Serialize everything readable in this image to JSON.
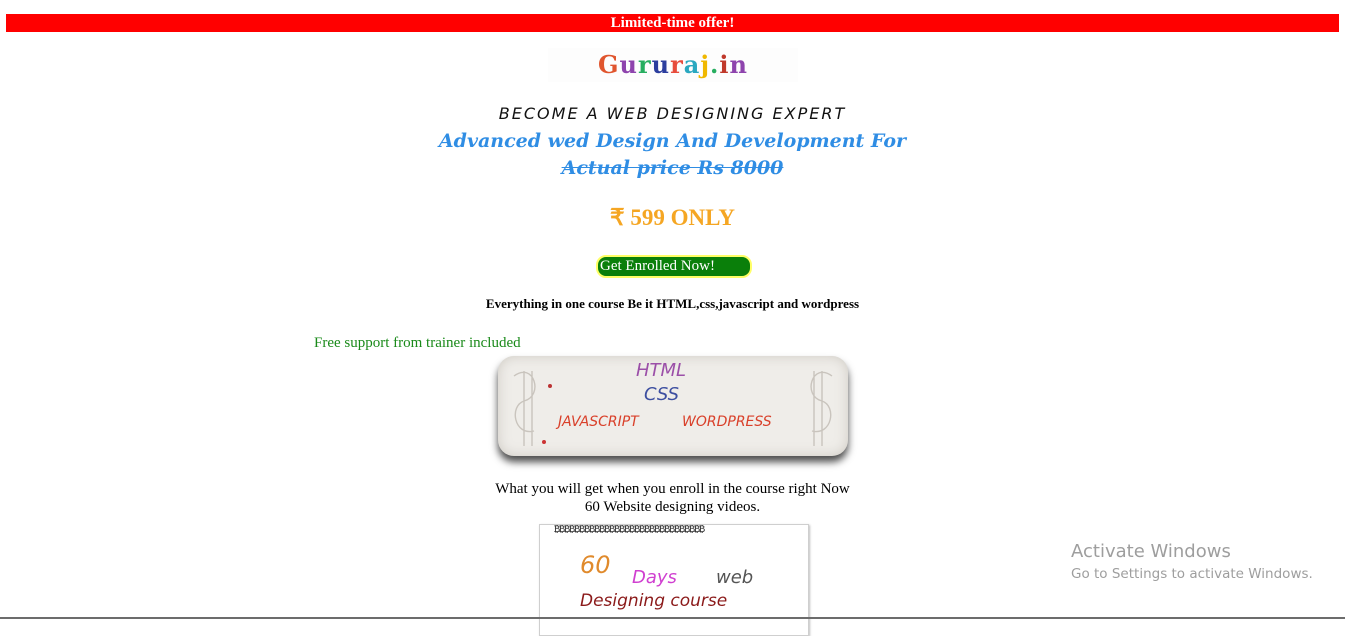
{
  "offer": {
    "text": "Limited-time offer!"
  },
  "logo": {
    "letters": [
      "G",
      "u",
      "r",
      "u",
      "r",
      "a",
      "j",
      ".",
      "i",
      "n"
    ],
    "colors": [
      "#e74c3c",
      "#8e44ad",
      "#2c3e50",
      "#2980b9",
      "#c0392b",
      "#16a085",
      "#e67e22",
      "#27ae60",
      "#d35400",
      "#8e44ad"
    ]
  },
  "hero": {
    "tagline": "BECOME A WEB DESIGNING EXPERT",
    "headline": "Advanced wed Design And Development For",
    "actual_price": "Actual price Rs 8000",
    "price": "₹ 599 ONLY",
    "enroll_label": "Get Enrolled Now!",
    "everything": "Everything in one course Be it HTML,css,javascript and wordpress",
    "support": "Free support from trainer included"
  },
  "tech_card": {
    "html": "HTML",
    "css": "CSS",
    "javascript": "JAVASCRIPT",
    "wordpress": "WORDPRESS"
  },
  "details": {
    "what_line": "What you will get when you enroll in the course right Now",
    "videos_line": "60 Website designing videos."
  },
  "notebook": {
    "n60": "60",
    "days": "Days",
    "web": "web",
    "designing": "Designing course"
  },
  "watermark": {
    "title": "Activate Windows",
    "subtitle": "Go to Settings to activate Windows."
  },
  "colors": {
    "offer_bg": "#ff0000",
    "price": "#f5a623",
    "enroll_bg": "#0a7f0a",
    "headline": "#2f8de4",
    "support": "#1a8a1a"
  }
}
